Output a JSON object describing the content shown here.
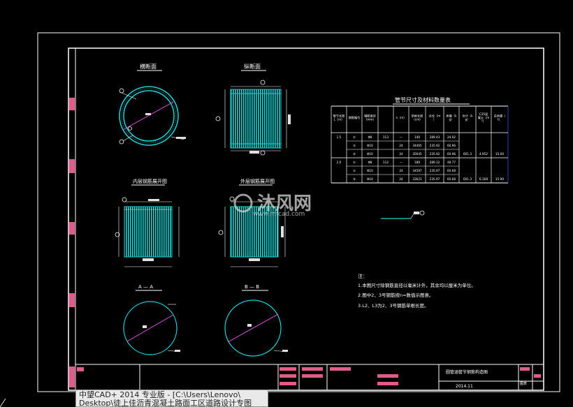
{
  "views": {
    "section_circle_title": "横断面",
    "section_side_title": "纵断面",
    "inner_unfold_title": "内层钢筋展开图",
    "outer_unfold_title": "外层钢筋展开图",
    "cut_a_title": "A — A",
    "cut_b_title": "B — B"
  },
  "table": {
    "title": "管节尺寸及材料数量表",
    "headers": [
      "管节长度L（m）",
      "钢筋编号",
      "钢筋直径（mm）",
      "",
      "n（m）",
      "单根长度（cm）",
      "共长（m）",
      "质量（kg）",
      "合计（kg）",
      "C25混凝土（m³）",
      "总质量（t）"
    ],
    "rows": [
      [
        "1.5",
        "①",
        "Φ8",
        "113",
        "—",
        "140",
        "289.43",
        "24.02",
        "",
        "",
        ""
      ],
      [
        "",
        "②",
        "Φ10",
        "",
        "24",
        "34465",
        "235.92",
        "60.96",
        "",
        "",
        ""
      ],
      [
        "",
        "③",
        "Φ10",
        "",
        "24",
        "35645",
        "235.92",
        "60.96",
        "601.3",
        "4.952",
        "15.00"
      ],
      [
        "2.0",
        "①",
        "Φ8",
        "112",
        "—",
        "189",
        "289.12",
        "48.77",
        "",
        "",
        ""
      ],
      [
        "",
        "②",
        "Φ10",
        "",
        "24",
        "34597",
        "235.97",
        "60.68",
        "",
        "",
        ""
      ],
      [
        "",
        "③",
        "Φ10",
        "",
        "24",
        "33621",
        "235.97",
        "60.68",
        "601.3",
        "6.168",
        "15.90"
      ]
    ]
  },
  "notes": {
    "heading": "注：",
    "lines": [
      "1.本图尺寸除钢筋直径以毫米计外，其余均以厘米为单位。",
      "2.图中2、3号钢筋按n=数值示图意。",
      "3.L2、L3为2、3号钢筋单根长度。"
    ]
  },
  "title_block": {
    "drawing_title": "圆管涵管节钢筋构造图",
    "date": "2014.11",
    "sheet_label": "图表"
  },
  "watermark": {
    "name": "沐风网",
    "url": "www.mfcad.com"
  },
  "tooltip": {
    "line1": "中望CAD+ 2014 专业版 - [C:\\Users\\Lenovo\\",
    "line2": "Desktop\\徒上佳沥青混凝土路面工区道路设计专图"
  }
}
